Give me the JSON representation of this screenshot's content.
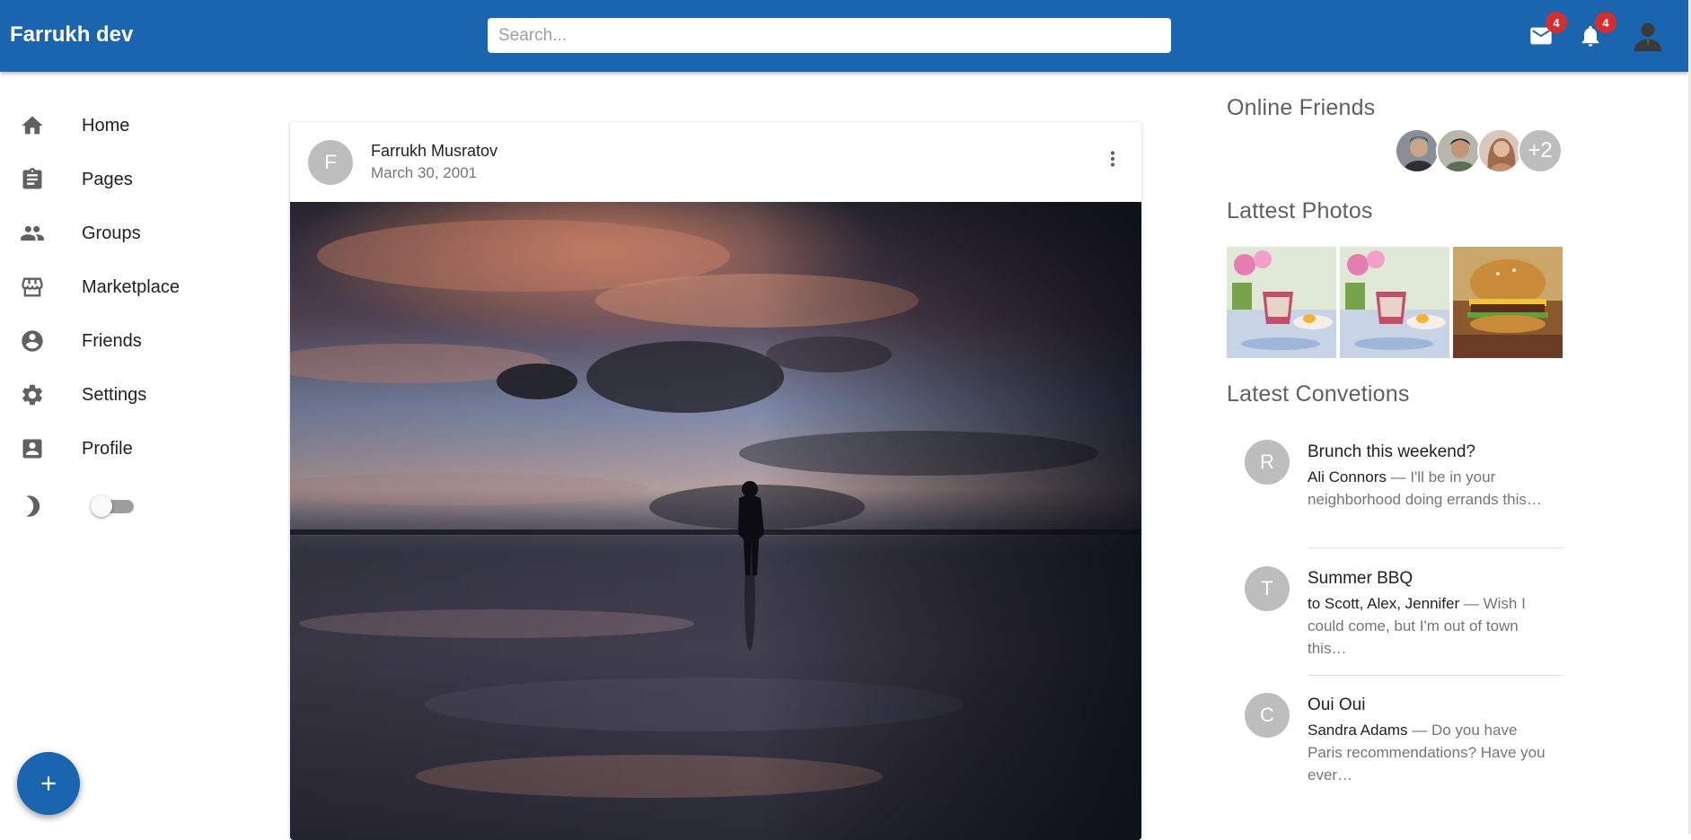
{
  "app": {
    "title": "Farrukh dev"
  },
  "search": {
    "placeholder": "Search..."
  },
  "header": {
    "mail_badge": "4",
    "notifications_badge": "4"
  },
  "sidebar": {
    "items": [
      {
        "label": "Home",
        "icon": "home-icon"
      },
      {
        "label": "Pages",
        "icon": "clipboard-icon"
      },
      {
        "label": "Groups",
        "icon": "group-icon"
      },
      {
        "label": "Marketplace",
        "icon": "storefront-icon"
      },
      {
        "label": "Friends",
        "icon": "account-circle-icon"
      },
      {
        "label": "Settings",
        "icon": "gear-icon"
      },
      {
        "label": "Profile",
        "icon": "account-box-icon"
      }
    ],
    "dark_mode": {
      "icon": "moon-icon",
      "enabled": false
    }
  },
  "fab": {
    "label": "+"
  },
  "post": {
    "avatar_letter": "F",
    "author": "Farrukh Musratov",
    "date": "March 30, 2001"
  },
  "right": {
    "online_title": "Online Friends",
    "online_more": "+2",
    "photos_title": "Lattest Photos",
    "conversations_title": "Latest Convetions",
    "conversations": [
      {
        "avatar": "R",
        "title": "Brunch this weekend?",
        "who": "Ali Connors",
        "text": " — I'll be in your neighborhood doing errands this…"
      },
      {
        "avatar": "T",
        "title": "Summer BBQ",
        "who": "to Scott, Alex, Jennifer",
        "text": " — Wish I could come, but I'm out of town this…"
      },
      {
        "avatar": "C",
        "title": "Oui Oui",
        "who": "Sandra Adams",
        "text": " — Do you have Paris recommendations? Have you ever…"
      }
    ]
  },
  "colors": {
    "primary": "#1b64ae",
    "badge": "#d32f2f",
    "avatar_gray": "#bdbdbd"
  }
}
